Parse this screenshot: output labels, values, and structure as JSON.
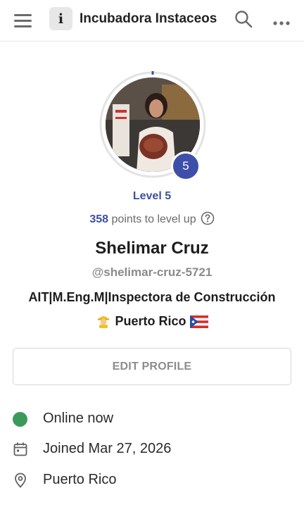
{
  "header": {
    "menu_icon": "hamburger-menu-icon",
    "app_logo_glyph": "i",
    "app_title": "Incubadora Instaceos",
    "search_icon": "search-icon",
    "more_icon": "more-horizontal-icon"
  },
  "profile": {
    "level_badge": "5",
    "level_label": "Level 5",
    "points_value": "358",
    "points_text": " points to level up",
    "name": "Shelimar Cruz",
    "handle": "@shelimar-cruz-5721",
    "bio_line1": "AIT|M.Eng.M|Inspectora de Construcción",
    "bio_line2_text": "Puerto Rico",
    "level_progress": 0.01,
    "accent_color": "#3d4fa8"
  },
  "actions": {
    "edit_profile_label": "EDIT PROFILE"
  },
  "details": {
    "status": "Online now",
    "status_color": "#3a9a5c",
    "joined": "Joined Mar 27, 2026",
    "location": "Puerto Rico"
  }
}
